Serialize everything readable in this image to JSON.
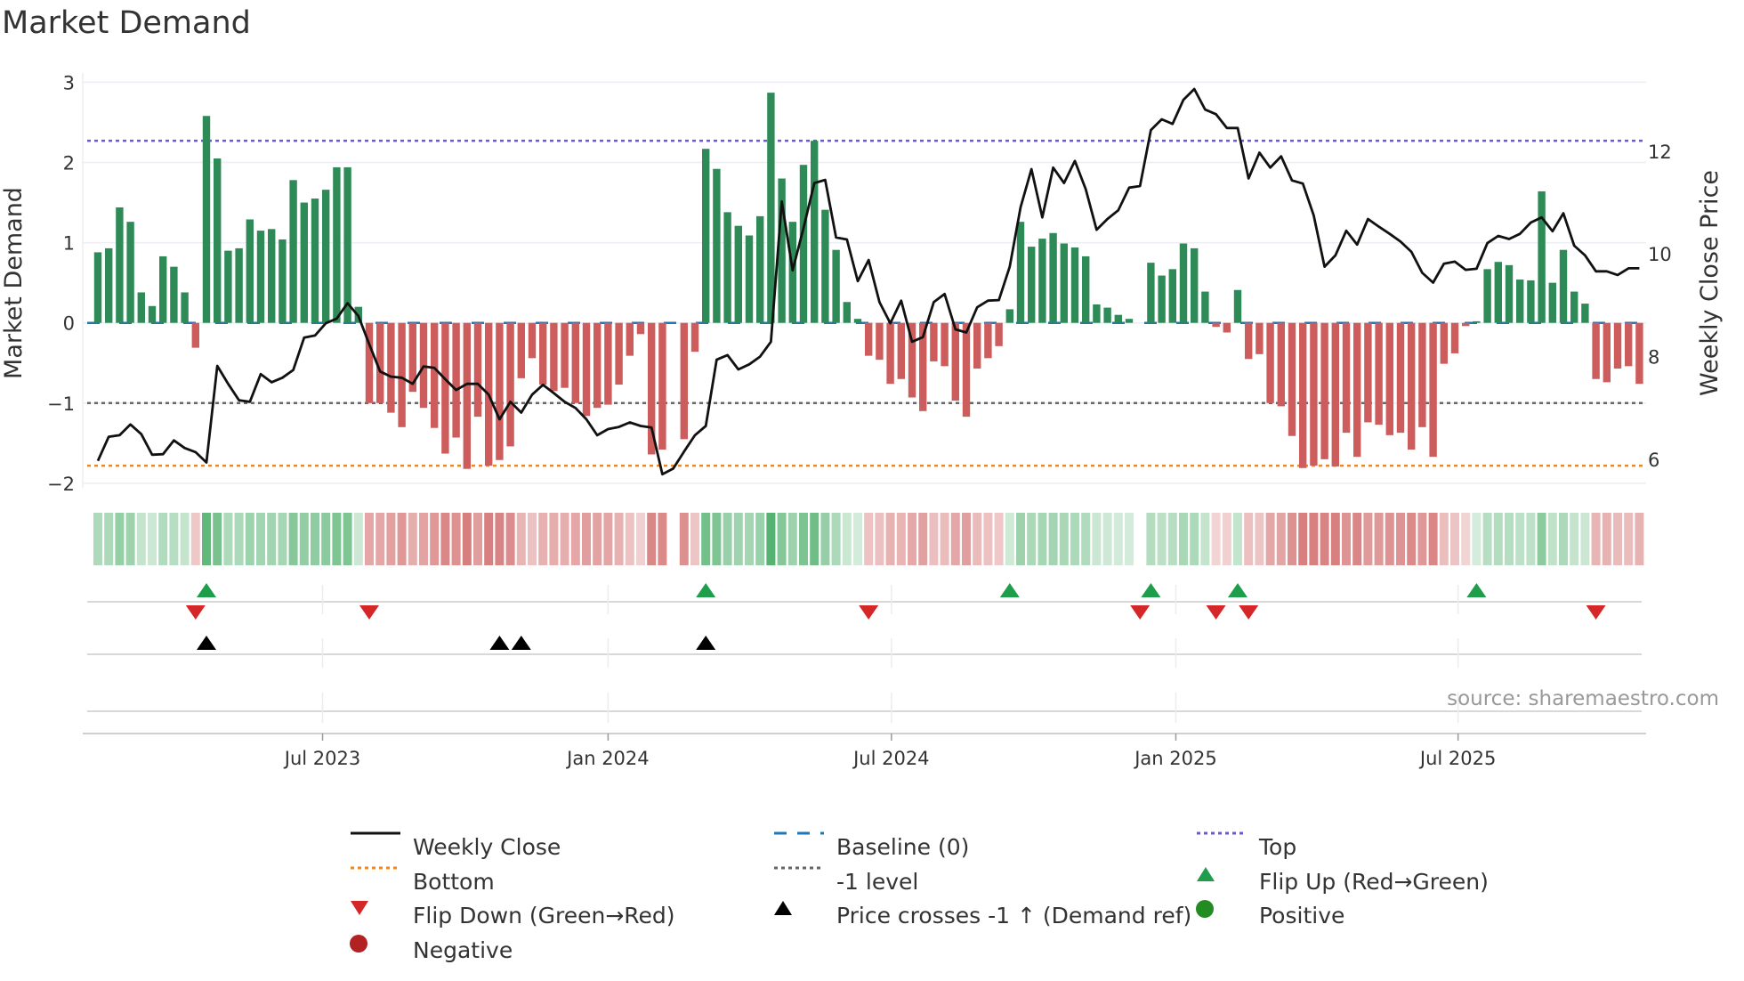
{
  "title": "Market Demand",
  "source": "source: sharemaestro.com",
  "chart_data": {
    "type": "bar",
    "title": "Market Demand",
    "ylabel": "Market Demand",
    "y2label": "Weekly Close Price",
    "ylim": [
      -2.1,
      3.1
    ],
    "y2lim": [
      5.0,
      13.9
    ],
    "yticks": [
      "3",
      "2",
      "1",
      "0",
      "−1",
      "−2"
    ],
    "ytick_values": [
      3,
      2,
      1,
      0,
      -1,
      -2
    ],
    "y2ticks": [
      "12",
      "10",
      "8",
      "6"
    ],
    "y2tick_values": [
      12,
      10,
      8,
      6
    ],
    "x_unit": "week index",
    "x_ticks": [
      {
        "label": "Jul 2023",
        "week": 20.7
      },
      {
        "label": "Jan 2024",
        "week": 47.0
      },
      {
        "label": "Jul 2024",
        "week": 73.1
      },
      {
        "label": "Jan 2025",
        "week": 99.3
      },
      {
        "label": "Jul 2025",
        "week": 125.3
      }
    ],
    "levels": {
      "top": 2.27,
      "bottom": -1.78,
      "minus_one": -1,
      "baseline": 0
    },
    "demand": [
      0.88,
      0.93,
      1.44,
      1.26,
      0.38,
      0.21,
      0.83,
      0.7,
      0.38,
      -0.31,
      2.58,
      2.05,
      0.9,
      0.93,
      1.29,
      1.15,
      1.17,
      1.04,
      1.78,
      1.5,
      1.55,
      1.66,
      1.94,
      1.94,
      0.2,
      -1.0,
      -1.0,
      -1.12,
      -1.3,
      -0.86,
      -1.06,
      -1.31,
      -1.63,
      -1.43,
      -1.82,
      -1.17,
      -1.78,
      -1.71,
      -1.54,
      -0.69,
      -0.44,
      -0.77,
      -0.85,
      -0.81,
      -1.0,
      -1.16,
      -1.06,
      -1.02,
      -0.77,
      -0.41,
      -0.14,
      -1.64,
      -1.58,
      0,
      -1.45,
      -0.36,
      2.17,
      1.92,
      1.38,
      1.21,
      1.09,
      1.33,
      2.87,
      1.8,
      1.26,
      1.97,
      2.27,
      1.41,
      0.91,
      0.26,
      0.05,
      -0.41,
      -0.46,
      -0.76,
      -0.7,
      -0.93,
      -1.1,
      -0.48,
      -0.54,
      -0.97,
      -1.17,
      -0.57,
      -0.44,
      -0.29,
      0.17,
      1.26,
      0.95,
      1.05,
      1.12,
      0.99,
      0.94,
      0.83,
      0.23,
      0.19,
      0.1,
      0.05,
      0,
      0.75,
      0.59,
      0.67,
      0.99,
      0.93,
      0.39,
      -0.05,
      -0.12,
      0.41,
      -0.45,
      -0.39,
      -1.0,
      -1.04,
      -1.41,
      -1.81,
      -1.78,
      -1.7,
      -1.79,
      -1.37,
      -1.67,
      -1.24,
      -1.27,
      -1.4,
      -1.37,
      -1.58,
      -1.3,
      -1.67,
      -0.51,
      -0.38,
      -0.04,
      0.02,
      0.67,
      0.76,
      0.72,
      0.54,
      0.53,
      1.64,
      0.5,
      0.91,
      0.39,
      0.24,
      -0.7,
      -0.74,
      -0.57,
      -0.54,
      -0.76
    ],
    "weekly_close": [
      5.97,
      6.44,
      6.47,
      6.68,
      6.49,
      6.09,
      6.1,
      6.37,
      6.22,
      6.14,
      5.94,
      7.82,
      7.47,
      7.15,
      7.12,
      7.66,
      7.5,
      7.59,
      7.74,
      8.37,
      8.41,
      8.65,
      8.74,
      9.04,
      8.79,
      8.24,
      7.71,
      7.61,
      7.59,
      7.47,
      7.81,
      7.78,
      7.56,
      7.35,
      7.47,
      7.47,
      7.26,
      6.78,
      7.12,
      6.91,
      7.26,
      7.45,
      7.29,
      7.12,
      7.0,
      6.78,
      6.47,
      6.59,
      6.63,
      6.72,
      6.65,
      6.62,
      5.71,
      5.82,
      6.15,
      6.47,
      6.65,
      7.94,
      8.03,
      7.75,
      7.85,
      8.0,
      8.29,
      11.02,
      9.68,
      10.5,
      11.38,
      11.44,
      10.32,
      10.28,
      9.47,
      9.88,
      9.06,
      8.65,
      9.09,
      8.29,
      8.38,
      9.06,
      9.22,
      8.53,
      8.47,
      8.96,
      9.09,
      9.1,
      9.75,
      10.91,
      11.65,
      10.71,
      11.68,
      11.38,
      11.81,
      11.26,
      10.47,
      10.68,
      10.85,
      11.29,
      11.32,
      12.41,
      12.62,
      12.53,
      13.0,
      13.21,
      12.81,
      12.72,
      12.45,
      12.45,
      11.47,
      11.97,
      11.68,
      11.9,
      11.43,
      11.37,
      10.75,
      9.75,
      9.97,
      10.45,
      10.18,
      10.68,
      10.53,
      10.39,
      10.24,
      10.04,
      9.63,
      9.44,
      9.81,
      9.85,
      9.69,
      9.71,
      10.21,
      10.35,
      10.29,
      10.39,
      10.61,
      10.71,
      10.44,
      10.79,
      10.16,
      9.97,
      9.66,
      9.66,
      9.59,
      9.72,
      9.72
    ],
    "flip_up_weeks": [
      10,
      56,
      84,
      97,
      105,
      127
    ],
    "flip_down_weeks": [
      9,
      25,
      71,
      96,
      103,
      106,
      138
    ],
    "price_cross_weeks": [
      10,
      37,
      39,
      56
    ],
    "colors": {
      "positive": "#2e8b57",
      "negative": "#cd5c5c",
      "price": "#111111",
      "top": "#6a5acd",
      "bottom": "#ee8a1b",
      "minus_one": "#666666",
      "baseline": "#1f77b4",
      "flip_up": "#1e9e4a",
      "flip_down": "#d62728",
      "cross": "#000000",
      "pos_dot": "#228b22",
      "neg_dot": "#b22222"
    },
    "legend": {
      "weekly_close": "Weekly Close",
      "baseline": "Baseline (0)",
      "top": "Top",
      "bottom": "Bottom",
      "minus_one": "-1 level",
      "flip_up": "Flip Up (Red→Green)",
      "flip_down": "Flip Down (Green→Red)",
      "cross": "Price crosses -1 ↑ (Demand ref)",
      "positive": "Positive",
      "negative": "Negative"
    },
    "legend_placement": "bottom"
  }
}
